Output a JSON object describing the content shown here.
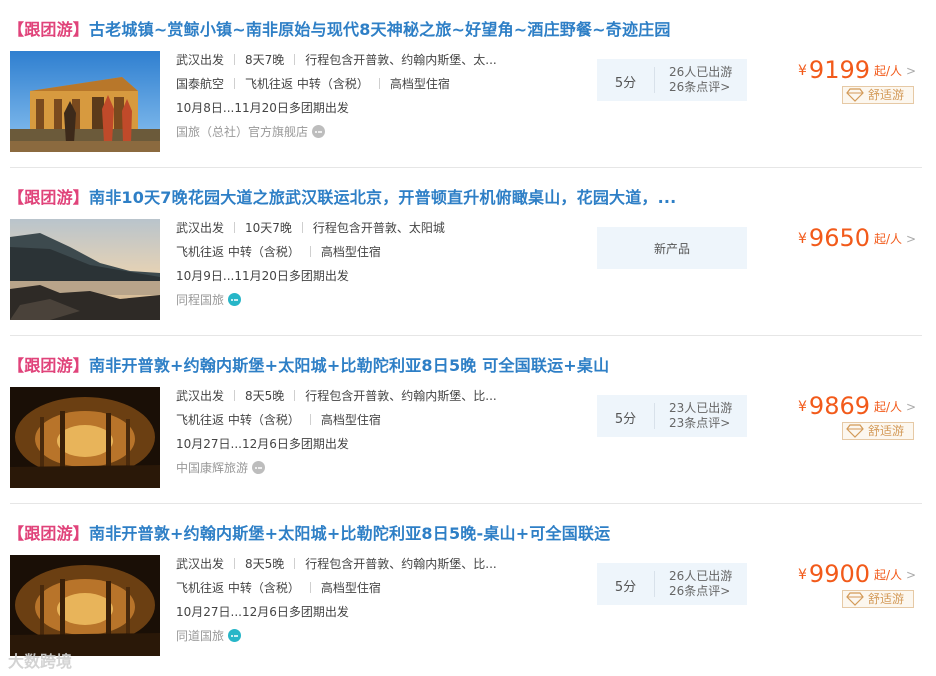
{
  "items": [
    {
      "tag": "【跟团游】",
      "title": "古老城镇~赏鲸小镇~南非原始与现代8天神秘之旅~好望角~酒庄野餐~奇迹庄园",
      "meta1": [
        "武汉出发",
        "8天7晚",
        "行程包含开普敦、约翰内斯堡、太..."
      ],
      "meta2": [
        "国泰航空",
        "飞机往返 中转（含税）",
        "高档型住宿"
      ],
      "dates": "10月8日...11月20日多团期出发",
      "seller": "国旅（总社）官方旗舰店",
      "score": "5分",
      "traveled": "26人已出游",
      "reviews": "26条点评>",
      "currency": "¥",
      "price": "9199",
      "unit": "起/人",
      "arrow": ">",
      "badge": "舒适游"
    },
    {
      "tag": "【跟团游】",
      "title": "南非10天7晚花园大道之旅武汉联运北京，开普顿直升机俯瞰桌山，花园大道，...",
      "meta1": [
        "武汉出发",
        "10天7晚",
        "行程包含开普敦、太阳城"
      ],
      "meta2": [
        "飞机往返 中转（含税）",
        "高档型住宿"
      ],
      "dates": "10月9日...11月20日多团期出发",
      "seller": "同程国旅",
      "new_product": "新产品",
      "currency": "¥",
      "price": "9650",
      "unit": "起/人",
      "arrow": ">"
    },
    {
      "tag": "【跟团游】",
      "title": "南非开普敦+约翰内斯堡+太阳城+比勒陀利亚8日5晚 可全国联运+桌山",
      "meta1": [
        "武汉出发",
        "8天5晚",
        "行程包含开普敦、约翰内斯堡、比..."
      ],
      "meta2": [
        "飞机往返 中转（含税）",
        "高档型住宿"
      ],
      "dates": "10月27日...12月6日多团期出发",
      "seller": "中国康辉旅游",
      "score": "5分",
      "traveled": "23人已出游",
      "reviews": "23条点评>",
      "currency": "¥",
      "price": "9869",
      "unit": "起/人",
      "arrow": ">",
      "badge": "舒适游"
    },
    {
      "tag": "【跟团游】",
      "title": "南非开普敦+约翰内斯堡+太阳城+比勒陀利亚8日5晚-桌山+可全国联运",
      "meta1": [
        "武汉出发",
        "8天5晚",
        "行程包含开普敦、约翰内斯堡、比..."
      ],
      "meta2": [
        "飞机往返 中转（含税）",
        "高档型住宿"
      ],
      "dates": "10月27日...12月6日多团期出发",
      "seller": "同道国旅",
      "score": "5分",
      "traveled": "26人已出游",
      "reviews": "26条点评>",
      "currency": "¥",
      "price": "9900",
      "unit": "起/人",
      "arrow": ">",
      "badge": "舒适游"
    }
  ],
  "watermark": "大数跨境",
  "colors": {
    "tag": "#e0437a",
    "title": "#2e7fc6",
    "price": "#f25a1a",
    "badge_text": "#d39a58",
    "review_bg": "#eef5fb"
  },
  "icons": {
    "chat": "chat-bubble-icon",
    "badge": "diamond-icon",
    "thumb_1": "castle-building-photo",
    "thumb_2": "coast-sunset-photo",
    "thumb_3": "cave-photo",
    "thumb_4": "cave-photo"
  }
}
